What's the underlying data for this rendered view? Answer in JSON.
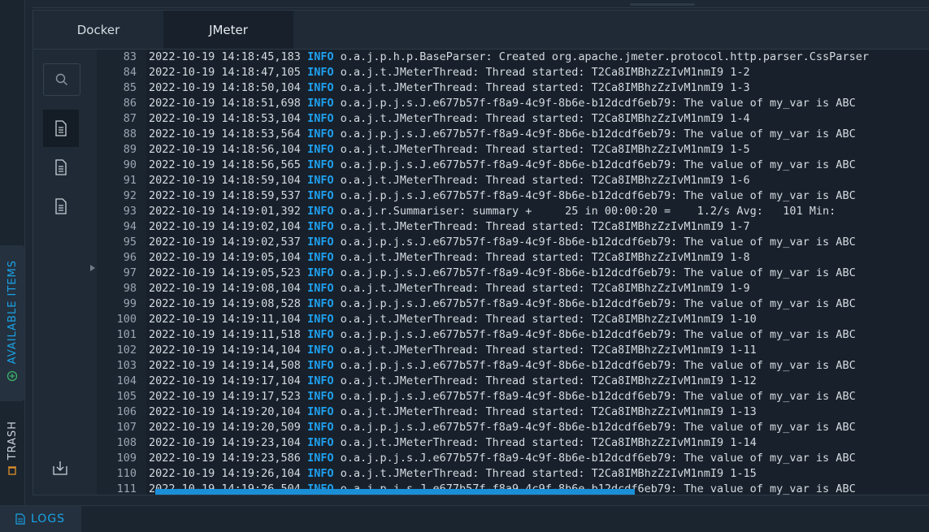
{
  "rail": {
    "available_label": "AVAILABLE ITEMS",
    "trash_label": "TRASH"
  },
  "tabs": [
    {
      "label": "Docker",
      "active": false
    },
    {
      "label": "JMeter",
      "active": true
    }
  ],
  "bottom": {
    "logs_label": "LOGS"
  },
  "colors": {
    "accent": "#1fa0f0",
    "background": "#18212b",
    "text": "#d4dae0"
  },
  "log_lines": [
    {
      "n": "83",
      "ts": "2022-10-19 14:18:45,183",
      "level": "INFO",
      "msg": "o.a.j.p.h.p.BaseParser: Created org.apache.jmeter.protocol.http.parser.CssParser"
    },
    {
      "n": "84",
      "ts": "2022-10-19 14:18:47,105",
      "level": "INFO",
      "msg": "o.a.j.t.JMeterThread: Thread started: T2Ca8IMBhzZzIvM1nmI9 1-2"
    },
    {
      "n": "85",
      "ts": "2022-10-19 14:18:50,104",
      "level": "INFO",
      "msg": "o.a.j.t.JMeterThread: Thread started: T2Ca8IMBhzZzIvM1nmI9 1-3"
    },
    {
      "n": "86",
      "ts": "2022-10-19 14:18:51,698",
      "level": "INFO",
      "msg": "o.a.j.p.j.s.J.e677b57f-f8a9-4c9f-8b6e-b12dcdf6eb79: The value of my_var is ABC"
    },
    {
      "n": "87",
      "ts": "2022-10-19 14:18:53,104",
      "level": "INFO",
      "msg": "o.a.j.t.JMeterThread: Thread started: T2Ca8IMBhzZzIvM1nmI9 1-4"
    },
    {
      "n": "88",
      "ts": "2022-10-19 14:18:53,564",
      "level": "INFO",
      "msg": "o.a.j.p.j.s.J.e677b57f-f8a9-4c9f-8b6e-b12dcdf6eb79: The value of my_var is ABC"
    },
    {
      "n": "89",
      "ts": "2022-10-19 14:18:56,104",
      "level": "INFO",
      "msg": "o.a.j.t.JMeterThread: Thread started: T2Ca8IMBhzZzIvM1nmI9 1-5"
    },
    {
      "n": "90",
      "ts": "2022-10-19 14:18:56,565",
      "level": "INFO",
      "msg": "o.a.j.p.j.s.J.e677b57f-f8a9-4c9f-8b6e-b12dcdf6eb79: The value of my_var is ABC"
    },
    {
      "n": "91",
      "ts": "2022-10-19 14:18:59,104",
      "level": "INFO",
      "msg": "o.a.j.t.JMeterThread: Thread started: T2Ca8IMBhzZzIvM1nmI9 1-6"
    },
    {
      "n": "92",
      "ts": "2022-10-19 14:18:59,537",
      "level": "INFO",
      "msg": "o.a.j.p.j.s.J.e677b57f-f8a9-4c9f-8b6e-b12dcdf6eb79: The value of my_var is ABC"
    },
    {
      "n": "93",
      "ts": "2022-10-19 14:19:01,392",
      "level": "INFO",
      "msg": "o.a.j.r.Summariser: summary +     25 in 00:00:20 =    1.2/s Avg:   101 Min:"
    },
    {
      "n": "94",
      "ts": "2022-10-19 14:19:02,104",
      "level": "INFO",
      "msg": "o.a.j.t.JMeterThread: Thread started: T2Ca8IMBhzZzIvM1nmI9 1-7"
    },
    {
      "n": "95",
      "ts": "2022-10-19 14:19:02,537",
      "level": "INFO",
      "msg": "o.a.j.p.j.s.J.e677b57f-f8a9-4c9f-8b6e-b12dcdf6eb79: The value of my_var is ABC"
    },
    {
      "n": "96",
      "ts": "2022-10-19 14:19:05,104",
      "level": "INFO",
      "msg": "o.a.j.t.JMeterThread: Thread started: T2Ca8IMBhzZzIvM1nmI9 1-8"
    },
    {
      "n": "97",
      "ts": "2022-10-19 14:19:05,523",
      "level": "INFO",
      "msg": "o.a.j.p.j.s.J.e677b57f-f8a9-4c9f-8b6e-b12dcdf6eb79: The value of my_var is ABC"
    },
    {
      "n": "98",
      "ts": "2022-10-19 14:19:08,104",
      "level": "INFO",
      "msg": "o.a.j.t.JMeterThread: Thread started: T2Ca8IMBhzZzIvM1nmI9 1-9"
    },
    {
      "n": "99",
      "ts": "2022-10-19 14:19:08,528",
      "level": "INFO",
      "msg": "o.a.j.p.j.s.J.e677b57f-f8a9-4c9f-8b6e-b12dcdf6eb79: The value of my_var is ABC"
    },
    {
      "n": "100",
      "ts": "2022-10-19 14:19:11,104",
      "level": "INFO",
      "msg": "o.a.j.t.JMeterThread: Thread started: T2Ca8IMBhzZzIvM1nmI9 1-10"
    },
    {
      "n": "101",
      "ts": "2022-10-19 14:19:11,518",
      "level": "INFO",
      "msg": "o.a.j.p.j.s.J.e677b57f-f8a9-4c9f-8b6e-b12dcdf6eb79: The value of my_var is ABC"
    },
    {
      "n": "102",
      "ts": "2022-10-19 14:19:14,104",
      "level": "INFO",
      "msg": "o.a.j.t.JMeterThread: Thread started: T2Ca8IMBhzZzIvM1nmI9 1-11"
    },
    {
      "n": "103",
      "ts": "2022-10-19 14:19:14,508",
      "level": "INFO",
      "msg": "o.a.j.p.j.s.J.e677b57f-f8a9-4c9f-8b6e-b12dcdf6eb79: The value of my_var is ABC"
    },
    {
      "n": "104",
      "ts": "2022-10-19 14:19:17,104",
      "level": "INFO",
      "msg": "o.a.j.t.JMeterThread: Thread started: T2Ca8IMBhzZzIvM1nmI9 1-12"
    },
    {
      "n": "105",
      "ts": "2022-10-19 14:19:17,523",
      "level": "INFO",
      "msg": "o.a.j.p.j.s.J.e677b57f-f8a9-4c9f-8b6e-b12dcdf6eb79: The value of my_var is ABC"
    },
    {
      "n": "106",
      "ts": "2022-10-19 14:19:20,104",
      "level": "INFO",
      "msg": "o.a.j.t.JMeterThread: Thread started: T2Ca8IMBhzZzIvM1nmI9 1-13"
    },
    {
      "n": "107",
      "ts": "2022-10-19 14:19:20,509",
      "level": "INFO",
      "msg": "o.a.j.p.j.s.J.e677b57f-f8a9-4c9f-8b6e-b12dcdf6eb79: The value of my_var is ABC"
    },
    {
      "n": "108",
      "ts": "2022-10-19 14:19:23,104",
      "level": "INFO",
      "msg": "o.a.j.t.JMeterThread: Thread started: T2Ca8IMBhzZzIvM1nmI9 1-14"
    },
    {
      "n": "109",
      "ts": "2022-10-19 14:19:23,586",
      "level": "INFO",
      "msg": "o.a.j.p.j.s.J.e677b57f-f8a9-4c9f-8b6e-b12dcdf6eb79: The value of my_var is ABC"
    },
    {
      "n": "110",
      "ts": "2022-10-19 14:19:26,104",
      "level": "INFO",
      "msg": "o.a.j.t.JMeterThread: Thread started: T2Ca8IMBhzZzIvM1nmI9 1-15"
    },
    {
      "n": "111",
      "ts": "2022-10-19 14:19:26,504",
      "level": "INFO",
      "msg": "o.a.j.p.j.s.J.e677b57f-f8a9-4c9f-8b6e-b12dcdf6eb79: The value of my_var is ABC"
    }
  ]
}
